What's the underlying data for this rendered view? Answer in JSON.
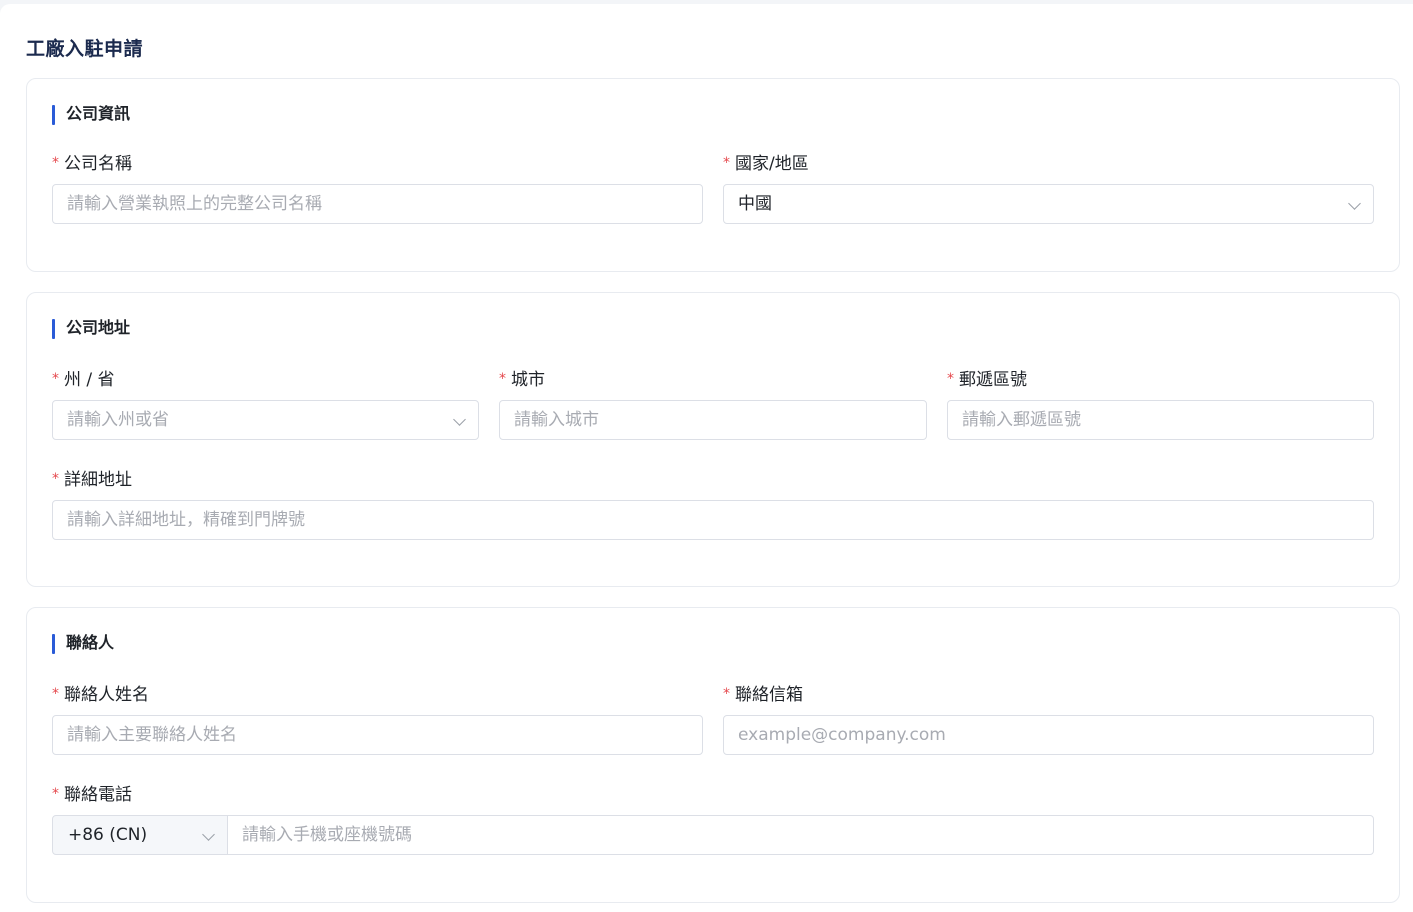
{
  "page": {
    "title": "工廠入駐申請"
  },
  "company_info": {
    "section_title": "公司資訊",
    "company_name": {
      "label": "公司名稱",
      "placeholder": "請輸入營業執照上的完整公司名稱"
    },
    "country": {
      "label": "國家/地區",
      "value": "中國"
    }
  },
  "company_address": {
    "section_title": "公司地址",
    "state": {
      "label": "州 / 省",
      "placeholder": "請輸入州或省"
    },
    "city": {
      "label": "城市",
      "placeholder": "請輸入城市"
    },
    "postal_code": {
      "label": "郵遞區號",
      "placeholder": "請輸入郵遞區號"
    },
    "detail_address": {
      "label": "詳細地址",
      "placeholder": "請輸入詳細地址，精確到門牌號"
    }
  },
  "contact": {
    "section_title": "聯絡人",
    "name": {
      "label": "聯絡人姓名",
      "placeholder": "請輸入主要聯絡人姓名"
    },
    "email": {
      "label": "聯絡信箱",
      "placeholder": "example@company.com"
    },
    "phone": {
      "label": "聯絡電話",
      "country_code": "+86 (CN)",
      "placeholder": "請輸入手機或座機號碼"
    }
  },
  "required_mark": "*",
  "colors": {
    "accent": "#2a5bd7",
    "required": "#e5484d",
    "title": "#1b2a4e"
  }
}
